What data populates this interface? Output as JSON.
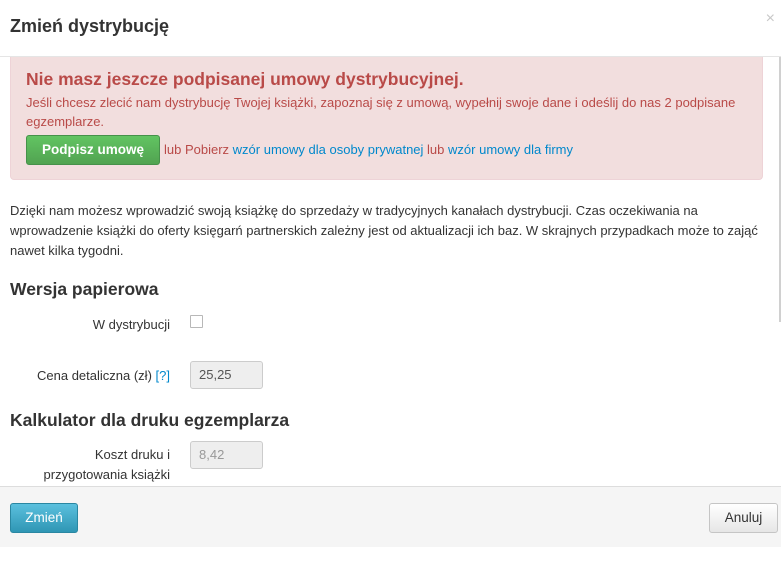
{
  "modal": {
    "title": "Zmień dystrybucję",
    "close": "×"
  },
  "alert": {
    "heading": "Nie masz jeszcze podpisanej umowy dystrybucyjnej.",
    "text": "Jeśli chcesz zlecić nam dystrybucję Twojej książki, zapoznaj się z umową, wypełnij swoje dane i odeślij do nas 2 podpisane egzemplarze.",
    "sign_button": "Podpisz umowę",
    "or_download": "lub Pobierz",
    "link_private": "wzór umowy dla osoby prywatnej",
    "or": "lub",
    "link_company": "wzór umowy dla firmy"
  },
  "intro": "Dzięki nam możesz wprowadzić swoją książkę do sprzedaży w tradycyjnych kanałach dystrybucji. Czas oczekiwania na wprowadzenie książki do oferty księgarń partnerskich zależny jest od aktualizacji ich baz. W skrajnych przypadkach może to zająć nawet kilka tygodni.",
  "paper": {
    "heading": "Wersja papierowa",
    "in_distribution_label": "W dystrybucji",
    "in_distribution_checked": false,
    "price_label": "Cena detaliczna (zł)",
    "price_help": "[?]",
    "price_value": "25,25"
  },
  "calculator": {
    "heading": "Kalkulator dla druku egzemplarza",
    "cost_label_line1": "Koszt druku i",
    "cost_label_line2": "przygotowania książki",
    "cost_value": "8,42"
  },
  "footer": {
    "change_button": "Zmień",
    "cancel_button": "Anuluj"
  },
  "colors": {
    "alert_bg": "#f2dede",
    "alert_text": "#b94a48",
    "link": "#0088cc",
    "success_button": "#5bb75b",
    "info_button": "#49afcd"
  }
}
